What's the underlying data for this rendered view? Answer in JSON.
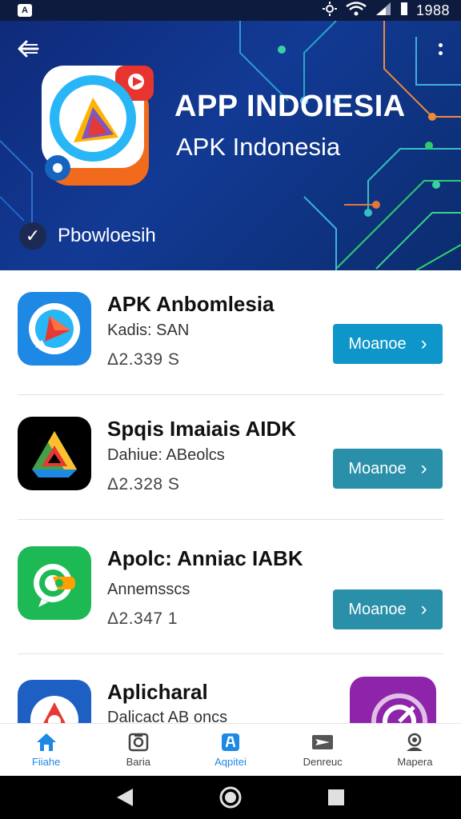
{
  "status_bar": {
    "time": "1988"
  },
  "hero": {
    "title": "APP INDOIESIA",
    "subtitle": "APK Indonesia",
    "verified_label": "Pbowloesih"
  },
  "apps": [
    {
      "name": "APK Anbomlesia",
      "meta": "Kadis: SAN",
      "stats": "Δ2.339  S",
      "button": "Moanoe",
      "button_color": "#0e95c9",
      "icon": "play-chat-icon"
    },
    {
      "name": "Spqis Imaiais AIDK",
      "meta": "Dahiue: ABeolcs",
      "stats": "Δ2.328  S",
      "button": "Moanoe",
      "button_color": "#2a8fa8",
      "icon": "triangle-drive-icon"
    },
    {
      "name": "Apolc: Anniac IABK",
      "meta": "Annemsscs",
      "stats": "Δ2.347  1",
      "button": "Moanoe",
      "button_color": "#2a8fa8",
      "icon": "chat-bubble-icon"
    },
    {
      "name": "Aplicharal",
      "meta": "Dalicact AB oncs",
      "stats": "",
      "icon": "arrow-app-icon",
      "extra_icon": "purple-app-icon"
    }
  ],
  "bottom_nav": [
    {
      "label": "Fiiahe",
      "icon": "home-icon",
      "active": true
    },
    {
      "label": "Baria",
      "icon": "camera-icon",
      "active": false
    },
    {
      "label": "Aqpitei",
      "icon": "apps-icon",
      "active": true
    },
    {
      "label": "Denreuc",
      "icon": "send-icon",
      "active": false
    },
    {
      "label": "Mapera",
      "icon": "profile-icon",
      "active": false
    }
  ],
  "colors": {
    "hero_bg": "#123a94",
    "accent": "#1e88e5",
    "button_primary": "#0e95c9",
    "button_secondary": "#2a8fa8"
  }
}
